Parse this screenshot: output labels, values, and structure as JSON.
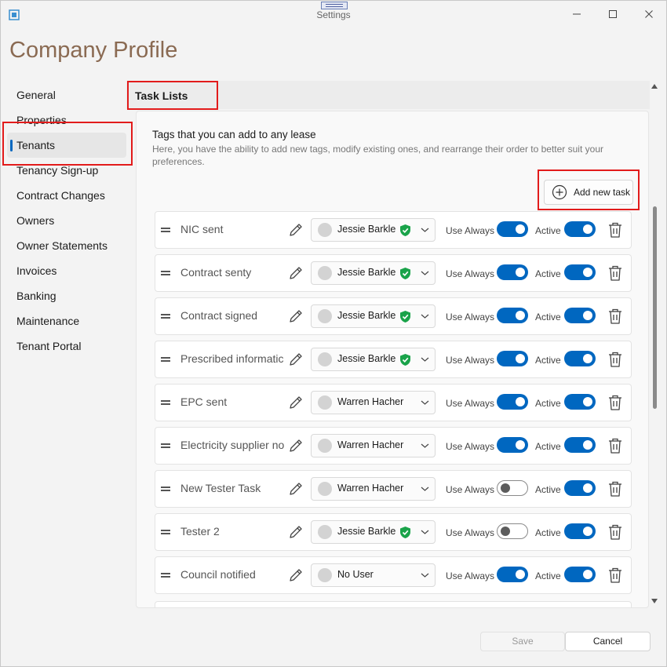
{
  "window": {
    "title": "Settings"
  },
  "page": {
    "title": "Company Profile"
  },
  "sidebar": {
    "items": [
      {
        "label": "General"
      },
      {
        "label": "Properties"
      },
      {
        "label": "Tenants"
      },
      {
        "label": "Tenancy Sign-up"
      },
      {
        "label": "Contract Changes"
      },
      {
        "label": "Owners"
      },
      {
        "label": "Owner Statements"
      },
      {
        "label": "Invoices"
      },
      {
        "label": "Banking"
      },
      {
        "label": "Maintenance"
      },
      {
        "label": "Tenant Portal"
      }
    ],
    "selected": "Tenants"
  },
  "content": {
    "title": "Task Lists",
    "heading": "Tags that you can add to any lease",
    "description": "Here, you have the ability to add new tags, modify existing ones, and rearrange their order to better suit your preferences.",
    "add_button_label": "Add new task",
    "use_always_label": "Use Always",
    "active_label": "Active",
    "tasks": [
      {
        "name": "NIC sent",
        "user": "Jessie Barkle",
        "verified": true,
        "use_always": true,
        "active": true
      },
      {
        "name": "Contract senty",
        "user": "Jessie Barkle",
        "verified": true,
        "use_always": true,
        "active": true
      },
      {
        "name": "Contract signed",
        "user": "Jessie Barkle",
        "verified": true,
        "use_always": true,
        "active": true
      },
      {
        "name": "Prescribed informatic",
        "user": "Jessie Barkle",
        "verified": true,
        "use_always": true,
        "active": true
      },
      {
        "name": "EPC sent",
        "user": "Warren Hacher",
        "verified": false,
        "use_always": true,
        "active": true
      },
      {
        "name": "Electricity supplier no",
        "user": "Warren Hacher",
        "verified": false,
        "use_always": true,
        "active": true
      },
      {
        "name": "New Tester Task",
        "user": "Warren Hacher",
        "verified": false,
        "use_always": false,
        "active": true
      },
      {
        "name": "Tester 2",
        "user": "Jessie Barkle",
        "verified": true,
        "use_always": false,
        "active": true
      },
      {
        "name": "Council notified",
        "user": "No User",
        "verified": false,
        "use_always": true,
        "active": true
      }
    ]
  },
  "footer": {
    "save_label": "Save",
    "cancel_label": "Cancel"
  },
  "colors": {
    "accent": "#0067c0",
    "verified": "#1aa34a",
    "highlight": "#e21b1b",
    "title": "#8a6a52"
  }
}
